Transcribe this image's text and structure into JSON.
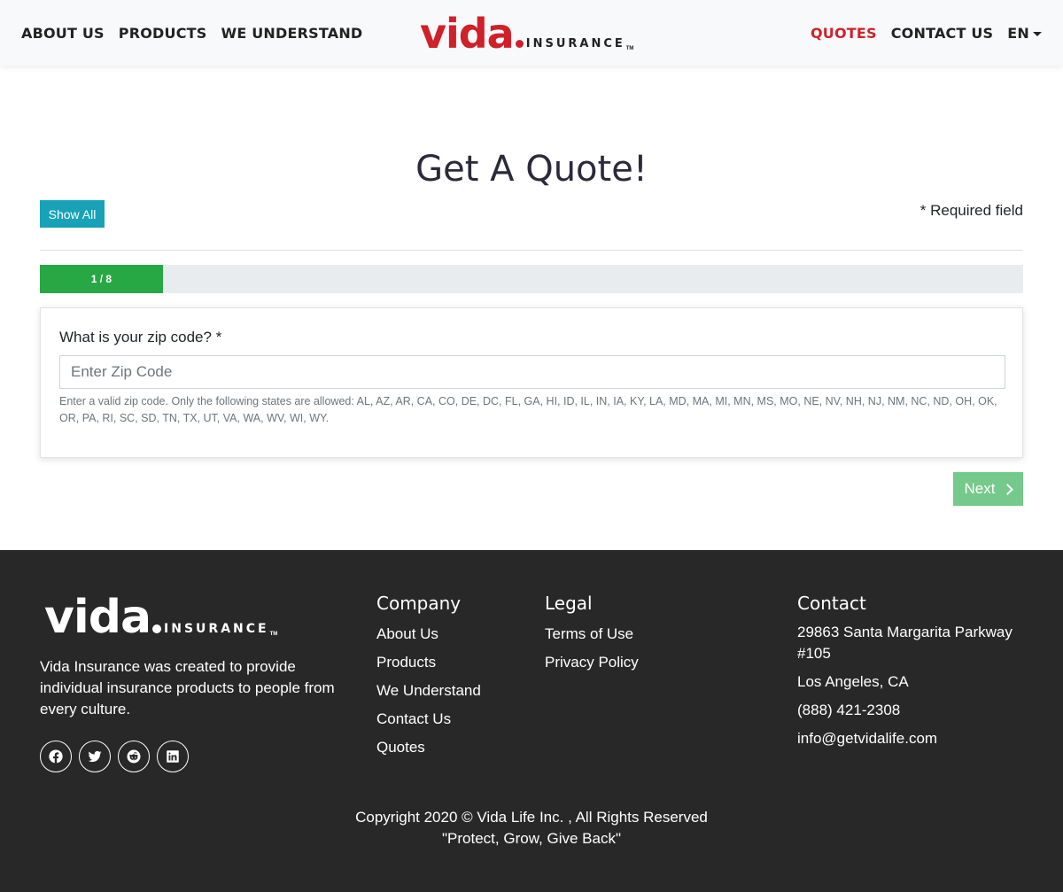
{
  "nav": {
    "left_links": [
      "ABOUT US",
      "PRODUCTS",
      "WE UNDERSTAND"
    ],
    "quotes": "QUOTES",
    "contact": "CONTACT US",
    "language": "EN",
    "logo": {
      "word": "vida",
      "suffix": "INSURANCE",
      "tm": "TM"
    }
  },
  "main": {
    "title": "Get A Quote!",
    "show_all": "Show All",
    "required_note": "* Required field",
    "progress": {
      "label": "1 / 8",
      "fraction": 0.125
    },
    "question": "What is your zip code? *",
    "zip_placeholder": "Enter Zip Code",
    "help_text": "Enter a valid zip code. Only the following states are allowed: AL, AZ, AR, CA, CO, DE, DC, FL, GA, HI, ID, IL, IN, IA, KY, LA, MD, MA, MI, MN, MS, MO, NE, NV, NH, NJ, NM, NC, ND, OH, OK, OR, PA, RI, SC, SD, TN, TX, UT, VA, WA, WV, WI, WY.",
    "next": "Next"
  },
  "footer": {
    "about": "Vida Insurance was created to provide individual insurance products to people from every culture.",
    "socials": [
      "facebook-icon",
      "twitter-icon",
      "reddit-icon",
      "linkedin-icon"
    ],
    "company": {
      "heading": "Company",
      "items": [
        "About Us",
        "Products",
        "We Understand",
        "Contact Us",
        "Quotes"
      ]
    },
    "legal": {
      "heading": "Legal",
      "items": [
        "Terms of Use",
        "Privacy Policy"
      ]
    },
    "contact": {
      "heading": "Contact",
      "address": "29863 Santa Margarita Parkway #105",
      "city": "Los Angeles, CA",
      "phone": "(888) 421-2308",
      "email": "info@getvidalife.com"
    },
    "copyright": "Copyright 2020 © Vida Life Inc. , All Rights Reserved",
    "tagline": "\"Protect, Grow, Give Back\""
  },
  "colors": {
    "brand_red": "#d0202a",
    "progress_green": "#28a745",
    "next_green": "#74c98b",
    "info_teal": "#17a2b8",
    "footer_bg": "#282828"
  }
}
